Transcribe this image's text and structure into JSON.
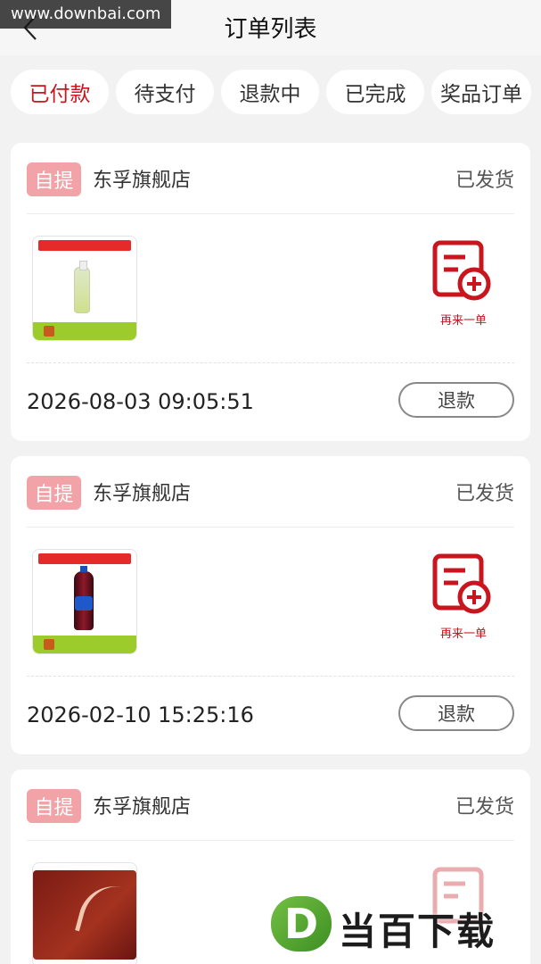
{
  "watermark_top": "www.downbai.com",
  "header": {
    "title": "订单列表"
  },
  "tabs": [
    {
      "label": "已付款",
      "active": true
    },
    {
      "label": "待支付",
      "active": false
    },
    {
      "label": "退款中",
      "active": false
    },
    {
      "label": "已完成",
      "active": false
    },
    {
      "label": "奖品订单",
      "active": false
    }
  ],
  "orders": [
    {
      "tag": "自提",
      "store": "东孚旗舰店",
      "status": "已发货",
      "again_label": "再来一单",
      "time": "2026-08-03 09:05:51",
      "refund_label": "退款",
      "product_icon": "green-tea-bottle"
    },
    {
      "tag": "自提",
      "store": "东孚旗舰店",
      "status": "已发货",
      "again_label": "再来一单",
      "time": "2026-02-10 15:25:16",
      "refund_label": "退款",
      "product_icon": "pepsi-bottle"
    },
    {
      "tag": "自提",
      "store": "东孚旗舰店",
      "status": "已发货",
      "product_icon": "plum-candy-pack"
    }
  ],
  "brand_watermark": {
    "letter": "D",
    "text": "当百下载"
  },
  "colors": {
    "accent": "#c8151e",
    "tag_bg": "#f2a3a8",
    "page_bg": "#f2f2f2"
  }
}
